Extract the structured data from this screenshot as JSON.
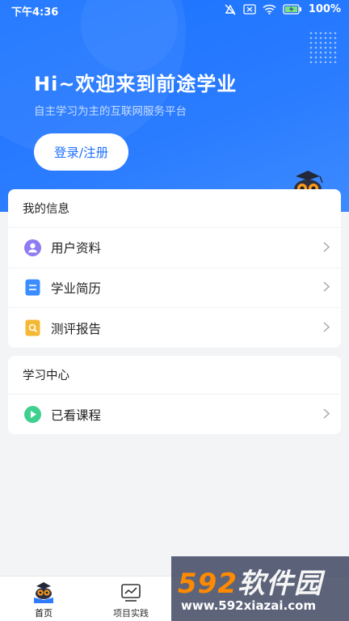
{
  "status_bar": {
    "time": "下午4:36",
    "battery": "100%",
    "icons": [
      "mute-icon",
      "sim-icon",
      "wifi-icon",
      "battery-icon"
    ]
  },
  "hero": {
    "title": "Hi~欢迎来到前途学业",
    "subtitle": "自主学习为主的互联网服务平台",
    "login_label": "登录/注册",
    "accent": "#1f6fff"
  },
  "my_info": {
    "title": "我的信息",
    "items": [
      {
        "label": "用户资料",
        "icon": "user-profile-icon",
        "color": "#8f7cf2"
      },
      {
        "label": "学业简历",
        "icon": "resume-icon",
        "color": "#3a8cff"
      },
      {
        "label": "测评报告",
        "icon": "report-icon",
        "color": "#f5b835"
      }
    ]
  },
  "study_center": {
    "title": "学习中心",
    "items": [
      {
        "label": "已看课程",
        "icon": "play-course-icon",
        "color": "#3fcf8e"
      }
    ]
  },
  "tabbar": {
    "tabs": [
      {
        "label": "首页",
        "icon": "home-owl-icon"
      },
      {
        "label": "项目实践",
        "icon": "project-chart-icon"
      }
    ]
  },
  "watermark": {
    "brand_num": "592",
    "brand_text": "软件园",
    "url": "www.592xiazai.com"
  }
}
